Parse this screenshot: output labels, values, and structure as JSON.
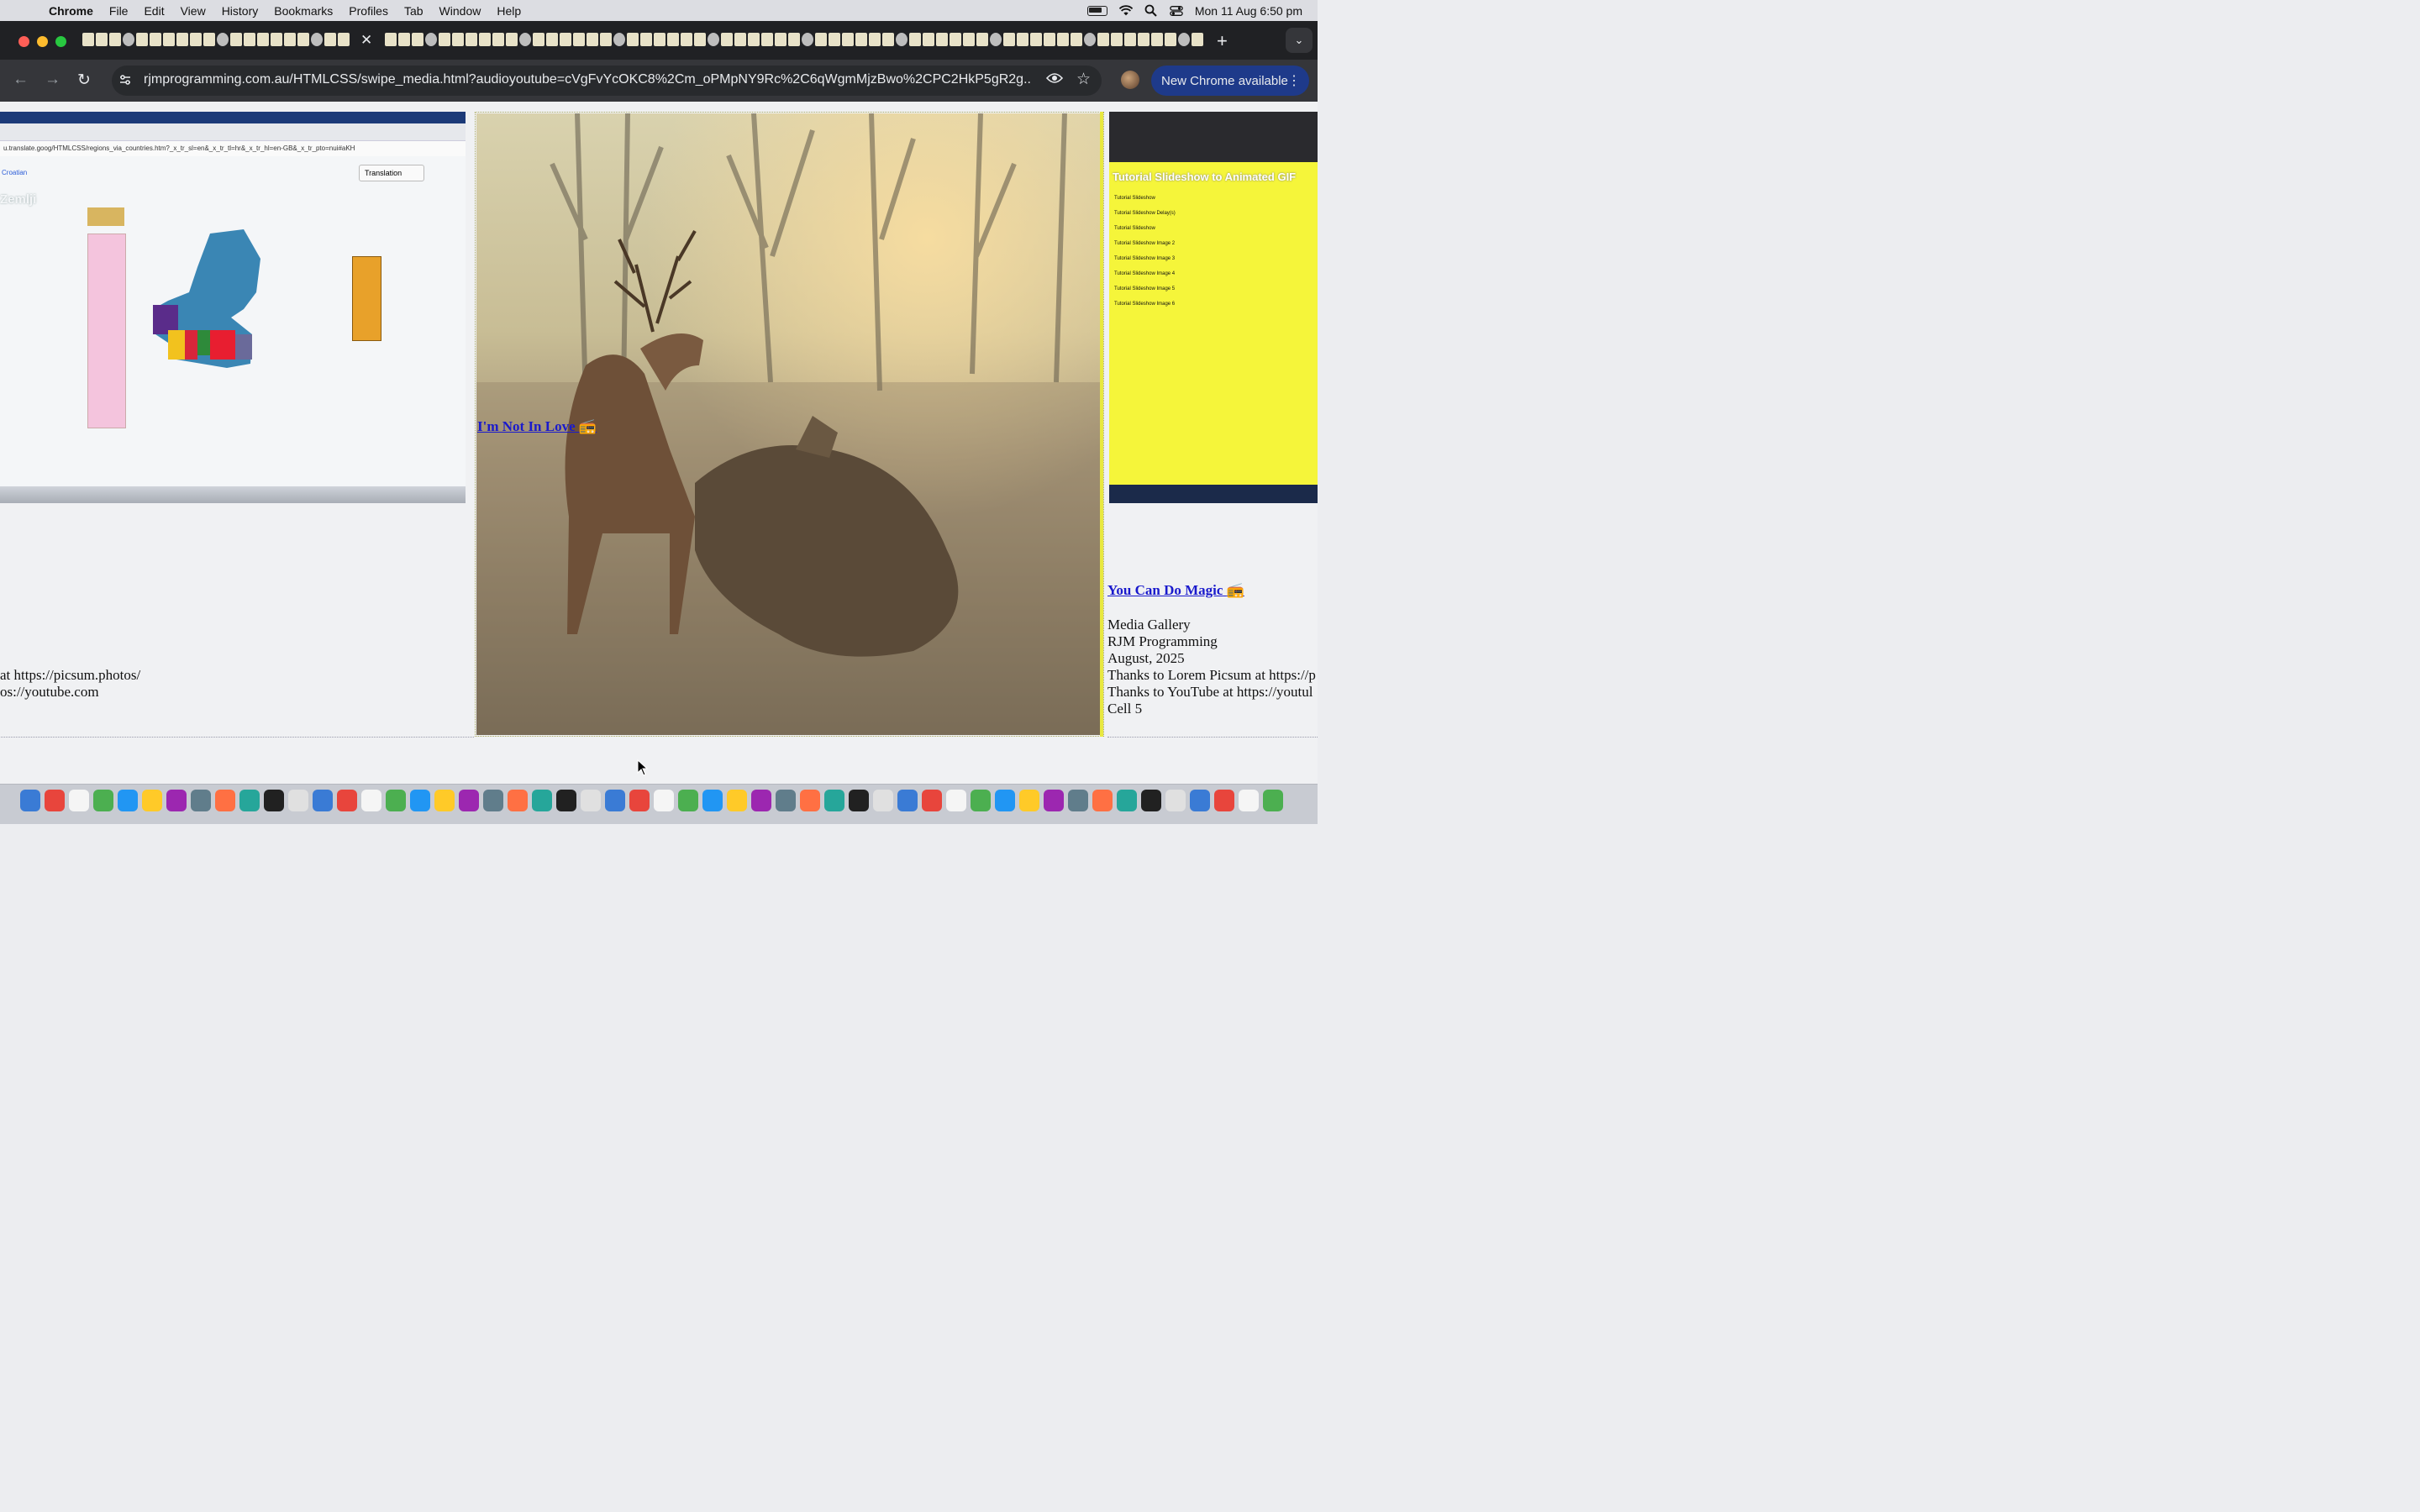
{
  "menubar": {
    "app": "Chrome",
    "items": [
      "File",
      "Edit",
      "View",
      "History",
      "Bookmarks",
      "Profiles",
      "Tab",
      "Window",
      "Help"
    ],
    "clock": "Mon 11 Aug  6:50 pm"
  },
  "browser": {
    "url": "rjmprogramming.com.au/HTMLCSS/swipe_media.html?audioyoutube=cVgFvYcOKC8%2Cm_oPMpNY9Rc%2C6qWgmMjzBwo%2CPC2HkP5gR2g...",
    "update_label": "New Chrome available"
  },
  "left_slide": {
    "shot_url": "u.translate.goog/HTMLCSS/regions_via_countries.htm?_x_tr_sl=en&_x_tr_tl=hr&_x_tr_hl=en-GB&_x_tr_pto=nui#aKH",
    "translation_btn": "Translation",
    "language": "Croatian",
    "heading": "Zemlji",
    "caption_line1": "at https://picsum.photos/",
    "caption_line2": "os://youtube.com"
  },
  "middle_slide": {
    "song_link": "I'm Not In Love"
  },
  "right_slide": {
    "shot_title": "Tutorial Slideshow to Animated GIF",
    "rows": [
      "Tutorial Slideshow",
      "Tutorial Slideshow Delay(s)",
      "Tutorial Slideshow",
      "Tutorial Slideshow Image 2",
      "Tutorial Slideshow Image 3",
      "Tutorial Slideshow Image 4",
      "Tutorial Slideshow Image 5",
      "Tutorial Slideshow Image 6"
    ],
    "song_link": "You Can Do Magic",
    "caption": [
      "Media Gallery",
      "RJM Programming",
      "August, 2025",
      "Thanks to Lorem Picsum at https://p",
      "Thanks to YouTube at https://youtul",
      "Cell 5"
    ]
  },
  "colors": {
    "menubar_bg": "#dcdde2",
    "tabbar_bg": "#202124",
    "toolbar_bg": "#35363a",
    "link": "#1a1acc",
    "update_btn": "#1e3a8a"
  }
}
